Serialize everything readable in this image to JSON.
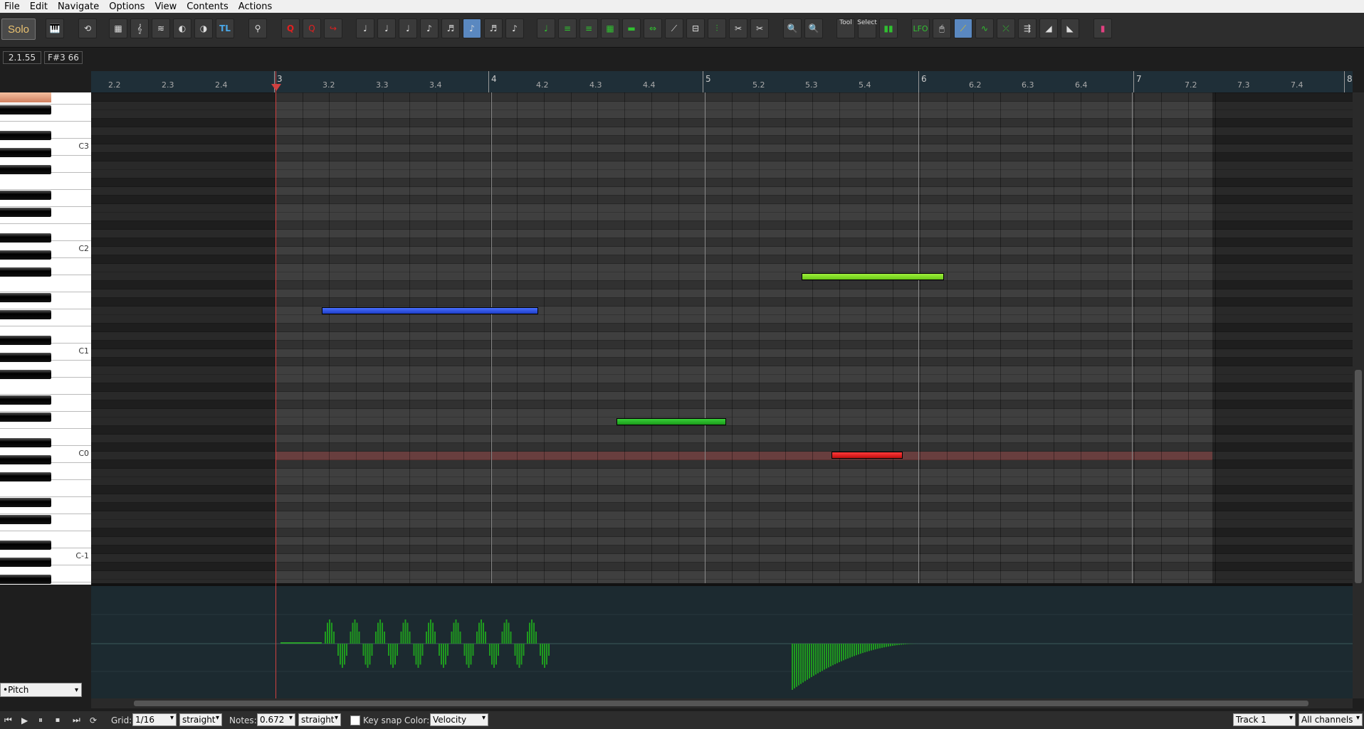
{
  "menu": [
    "File",
    "Edit",
    "Navigate",
    "Options",
    "View",
    "Contents",
    "Actions"
  ],
  "toolbar": {
    "solo_label": "Solo",
    "tl_label": "TL",
    "lfo_label": "LFO",
    "tool_label": "Tool",
    "select_label": "Select"
  },
  "position": {
    "time": "2.1.55",
    "note": "F#3  66"
  },
  "keyboard_labels": [
    "C3",
    "C2",
    "C1",
    "C0",
    "C-1"
  ],
  "ruler": {
    "labels": [
      "2.2",
      "2.3",
      "2.4",
      "3",
      "3.2",
      "3.3",
      "3.4",
      "4",
      "4.2",
      "4.3",
      "4.4",
      "5",
      "5.2",
      "5.3",
      "5.4",
      "6",
      "6.2",
      "6.3",
      "6.4",
      "7",
      "7.2",
      "7.3",
      "7.4",
      "8"
    ]
  },
  "notes_colors": {
    "blue": "#2a4fe0",
    "green_dark": "#22a622",
    "green_light": "#7ed81e",
    "red": "#e01818"
  },
  "cc_lane": {
    "selected": "•Pitch"
  },
  "status": {
    "grid_label": "Grid:",
    "grid_value": "1/16",
    "grid_swing": "straight",
    "notes_label": "Notes:",
    "notes_value": "0.672",
    "notes_swing": "straight",
    "keysnap_label": "Key snap",
    "color_label": "Color:",
    "color_value": "Velocity",
    "track": "Track 1",
    "channels": "All channels"
  }
}
